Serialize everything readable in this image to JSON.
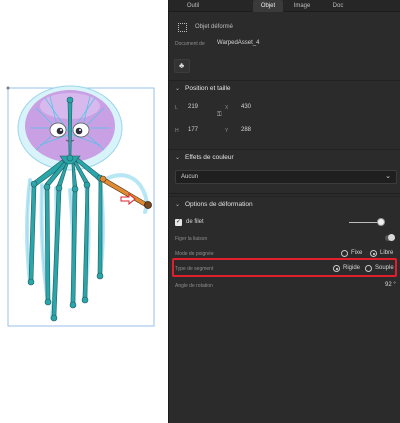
{
  "tabs": [
    {
      "label": "Outil",
      "active": false
    },
    {
      "label": "Objet",
      "active": true
    },
    {
      "label": "Image",
      "active": false
    },
    {
      "label": "Doc",
      "active": false
    }
  ],
  "object": {
    "type_label": "Objet déformé",
    "document_label": "Document de",
    "document_value": "WarpedAsset_4"
  },
  "position": {
    "header": "Position et taille",
    "l_label": "L",
    "l_value": "219",
    "x_label": "X",
    "x_value": "430",
    "h_label": "H",
    "h_value": "177",
    "y_label": "Y",
    "y_value": "288"
  },
  "color_effects": {
    "header": "Effets de couleur",
    "select_value": "Aucun"
  },
  "deform": {
    "header": "Options de déformation",
    "mesh_label": "de filet",
    "mesh_checked": true,
    "pin_label": "Figer la liaison",
    "handle_label": "Mode de poignée",
    "handle_fixed": "Fixe",
    "handle_free": "Libre",
    "handle_selected": "Libre",
    "segment_label": "Type de segment",
    "segment_rigid": "Rigide",
    "segment_soft": "Souple",
    "segment_selected": "Rigide",
    "rotation_label": "Angle de rotation",
    "rotation_value": "92 °"
  },
  "icons": {
    "warp": "warp-object-icon",
    "club": "club-icon",
    "link": "link-icon",
    "chevron": "chevron-down-icon",
    "arrow": "red-arrow-icon"
  },
  "colors": {
    "highlight": "#e0202c",
    "panel_bg": "#2b2b2b",
    "bone": "#2aa5a8",
    "jellyfish_head": "#c9a0e3"
  }
}
